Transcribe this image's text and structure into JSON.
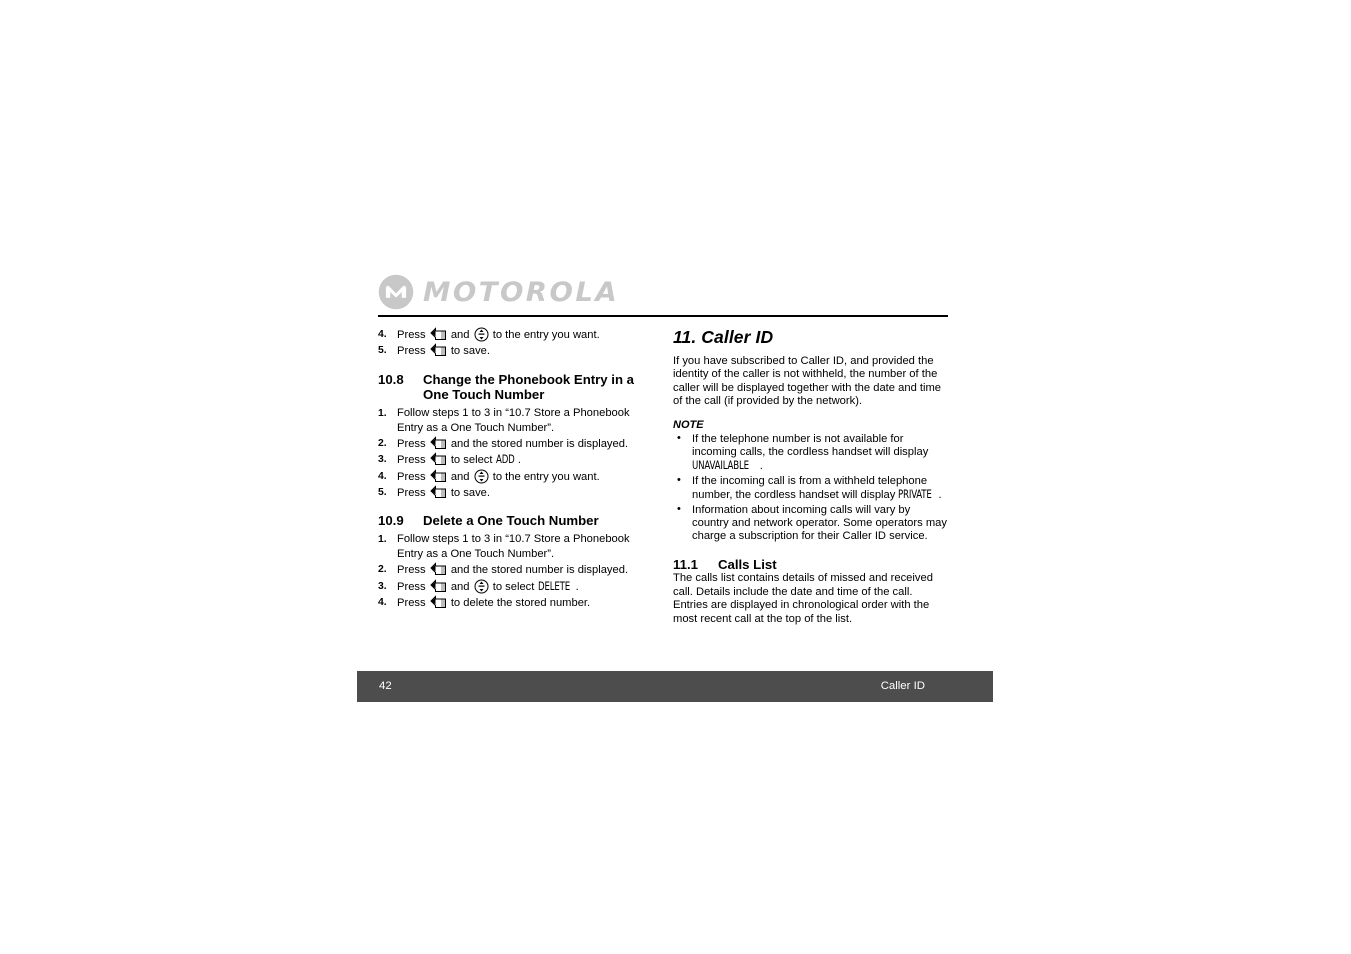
{
  "brand": {
    "logo_text": "MOTOROLA",
    "logo_color": "#c8c8c8",
    "logo_mark": "motorola-batwing-icon"
  },
  "icons": {
    "menu_key": "menu-soft-key-icon",
    "nav_key": "navigation-key-icon"
  },
  "left_column": {
    "continued_steps": [
      {
        "num": "4.",
        "pre": "Press",
        "mid": "and",
        "post": "to the entry you want.",
        "icons": [
          "menu-soft-key-icon",
          "navigation-key-icon"
        ]
      },
      {
        "num": "5.",
        "pre": "Press",
        "mid": "",
        "post": "to save.",
        "icons": [
          "menu-soft-key-icon"
        ]
      }
    ],
    "section_10_8": {
      "number": "10.8",
      "title": "Change the Phonebook Entry in a One Touch Number",
      "steps": [
        {
          "num": "1.",
          "text": "Follow steps 1 to 3 in “10.7 Store a Phonebook Entry as a One Touch Number”."
        },
        {
          "num": "2.",
          "pre": "Press",
          "post": "and the stored number is displayed."
        },
        {
          "num": "3.",
          "pre": "Press",
          "post": "to select",
          "lcd": "ADD",
          "end": "."
        },
        {
          "num": "4.",
          "pre": "Press",
          "mid": "and",
          "post": "to the entry you want."
        },
        {
          "num": "5.",
          "pre": "Press",
          "post": "to save."
        }
      ]
    },
    "section_10_9": {
      "number": "10.9",
      "title": "Delete a One Touch Number",
      "steps": [
        {
          "num": "1.",
          "text": "Follow steps 1 to 3 in “10.7 Store a Phonebook Entry as a One Touch Number”."
        },
        {
          "num": "2.",
          "pre": "Press",
          "post": "and the stored number is displayed."
        },
        {
          "num": "3.",
          "pre": "Press",
          "mid": "and",
          "post": "to select",
          "lcd": "DELETE",
          "end": "."
        },
        {
          "num": "4.",
          "pre": "Press",
          "post": "to delete the stored number."
        }
      ]
    }
  },
  "right_column": {
    "chapter_heading": "11. Caller ID",
    "intro": "If you have subscribed to Caller ID, and provided the identity of the caller is not withheld, the number of the caller will be displayed together with the date and time of the call (if provided by the network).",
    "note_label": "NOTE",
    "bullet_char": "•",
    "notes": [
      {
        "pre": "If the telephone number is not available for incoming calls, the cordless handset will display",
        "lcd": "UNAVAILABLE",
        "end": "."
      },
      {
        "pre": "If the incoming call is from a withheld telephone number, the cordless handset will display",
        "lcd": "PRIVATE",
        "end": "."
      },
      {
        "pre": "Information about incoming calls will vary by country and network operator. Some operators may charge a subscription for their Caller ID service.",
        "lcd": "",
        "end": ""
      }
    ],
    "section_11_1": {
      "number": "11.1",
      "title": "Calls List",
      "body": "The calls list contains details of missed and received call. Details include the date and time of the call. Entries are displayed in chronological order with the most recent call at the top of the list."
    }
  },
  "footer": {
    "page_number": "42",
    "chapter_title": "Caller ID",
    "background_color": "#4d4d4d",
    "text_color": "#ffffff"
  }
}
